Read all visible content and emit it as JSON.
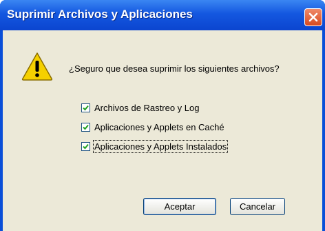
{
  "window": {
    "title": "Suprimir Archivos y Aplicaciones"
  },
  "icons": {
    "close": "close-icon",
    "warning": "warning-icon"
  },
  "message": "¿Seguro que desea suprimir los siguientes archivos?",
  "options": [
    {
      "label": "Archivos de Rastreo y Log",
      "checked": true
    },
    {
      "label": "Aplicaciones y Applets en Caché",
      "checked": true
    },
    {
      "label": "Aplicaciones y Applets Instalados",
      "checked": true
    }
  ],
  "buttons": {
    "ok": "Aceptar",
    "cancel": "Cancelar"
  },
  "colors": {
    "titlebar": "#1457e0",
    "client": "#ece9d8",
    "close": "#d84a1f",
    "warning": "#f5d000"
  }
}
